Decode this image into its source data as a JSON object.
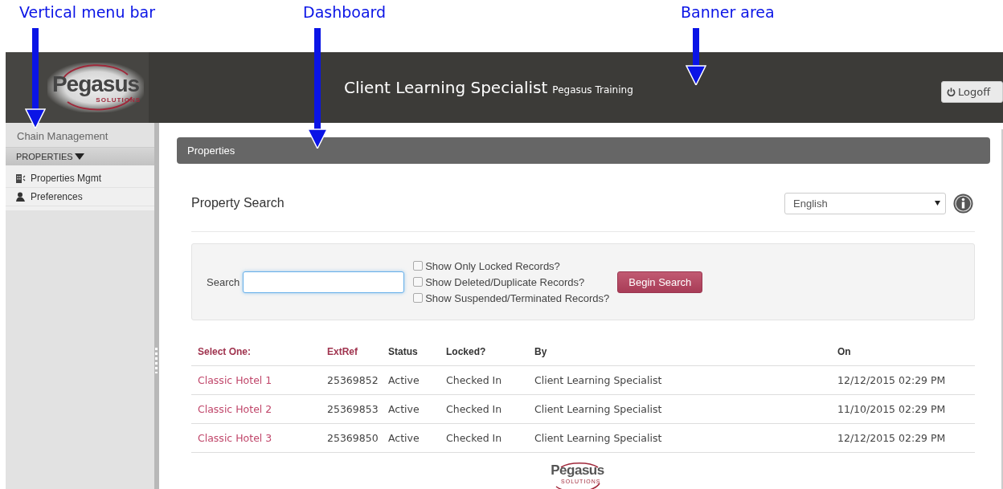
{
  "annotations": [
    {
      "label": "Vertical menu bar"
    },
    {
      "label": "Dashboard"
    },
    {
      "label": "Banner area"
    }
  ],
  "banner": {
    "logo": {
      "name": "Pegasus",
      "tagline": "SOLUTIONS"
    },
    "title": "Client Learning Specialist",
    "subtitle": "Pegasus Training",
    "logoff": "Logoff"
  },
  "sidebar": {
    "top_item": "Chain Management",
    "section": {
      "label": "PROPERTIES",
      "expanded": true,
      "items": [
        {
          "label": "Properties Mgmt"
        },
        {
          "label": "Preferences"
        }
      ]
    }
  },
  "panel": {
    "title": "Properties"
  },
  "property_search": {
    "heading": "Property Search",
    "language": "English",
    "search": {
      "label": "Search"
    },
    "options": [
      {
        "label": "Show Only Locked Records?",
        "checked": false
      },
      {
        "label": "Show Deleted/Duplicate Records?",
        "checked": false
      },
      {
        "label": "Show Suspended/Terminated Records?",
        "checked": false
      }
    ],
    "button": "Begin Search"
  },
  "table": {
    "columns": [
      "Select One:",
      "ExtRef",
      "Status",
      "Locked?",
      "By",
      "On"
    ],
    "rows": [
      [
        "Classic Hotel 1",
        "25369852",
        "Active",
        "Checked In",
        "Client Learning Specialist",
        "12/12/2015 02:29 PM"
      ],
      [
        "Classic Hotel 2",
        "25369853",
        "Active",
        "Checked In",
        "Client Learning Specialist",
        "11/10/2015 02:29 PM"
      ],
      [
        "Classic Hotel 3",
        "25369850",
        "Active",
        "Checked In",
        "Client Learning Specialist",
        "12/12/2015 02:29 PM"
      ]
    ]
  },
  "footer_logo": {
    "name": "Pegasus",
    "tagline": "SOLUTIONS"
  }
}
